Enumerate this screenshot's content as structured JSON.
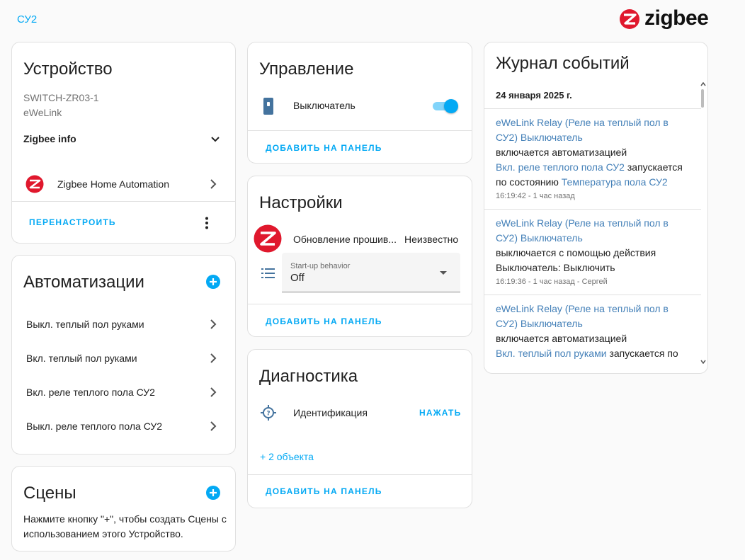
{
  "header": {
    "breadcrumb": "СУ2",
    "logo_text": "zigbee"
  },
  "device_card": {
    "title": "Устройство",
    "model": "SWITCH-ZR03-1",
    "manufacturer": "eWeLink",
    "zigbee_info_label": "Zigbee info",
    "integration_label": "Zigbee Home Automation",
    "reconfigure_label": "ПЕРЕНАСТРОИТЬ"
  },
  "automations_card": {
    "title": "Автоматизации",
    "items": [
      {
        "label": "Выкл. теплый пол руками"
      },
      {
        "label": "Вкл. теплый пол руками"
      },
      {
        "label": "Вкл. реле теплого пола СУ2"
      },
      {
        "label": "Выкл. реле теплого пола СУ2"
      }
    ]
  },
  "scenes_card": {
    "title": "Сцены",
    "description": "Нажмите кнопку \"+\", чтобы создать Сцены с использованием этого Устройство."
  },
  "controls_card": {
    "title": "Управление",
    "switch_label": "Выключатель",
    "switch_on": true,
    "add_to_panel": "ДОБАВИТЬ НА ПАНЕЛЬ"
  },
  "settings_card": {
    "title": "Настройки",
    "firmware_label": "Обновление прошив...",
    "firmware_value": "Неизвестно",
    "select_label": "Start-up behavior",
    "select_value": "Off",
    "add_to_panel": "ДОБАВИТЬ НА ПАНЕЛЬ"
  },
  "diagnostics_card": {
    "title": "Диагностика",
    "identify_label": "Идентификация",
    "identify_action": "НАЖАТЬ",
    "more_entities": "+ 2 объекта",
    "add_to_panel": "ДОБАВИТЬ НА ПАНЕЛЬ"
  },
  "logbook_card": {
    "title": "Журнал событий",
    "date": "24 января 2025 г.",
    "entries": [
      {
        "entity": "eWeLink Relay (Реле на теплый пол в СУ2) Выключатель",
        "message": "включается автоматизацией",
        "context_link": "Вкл. реле теплого пола СУ2",
        "context_text": "запускается по состоянию",
        "context_link2": "Температура пола СУ2",
        "time": "16:19:42 - 1 час назад"
      },
      {
        "entity": "eWeLink Relay (Реле на теплый пол в СУ2) Выключатель",
        "message": "выключается с помощью действия Выключатель: Выключить",
        "time": "16:19:36 - 1 час назад - Сергей"
      },
      {
        "entity": "eWeLink Relay (Реле на теплый пол в СУ2) Выключатель",
        "message": "включается автоматизацией",
        "context_link": "Вкл. теплый пол руками",
        "context_text": "запускается по"
      }
    ]
  },
  "colors": {
    "accent": "#03a9f4",
    "logbook_link": "#4480b8",
    "zigbee_red": "#e0182d",
    "device_icon": "#44739e"
  }
}
